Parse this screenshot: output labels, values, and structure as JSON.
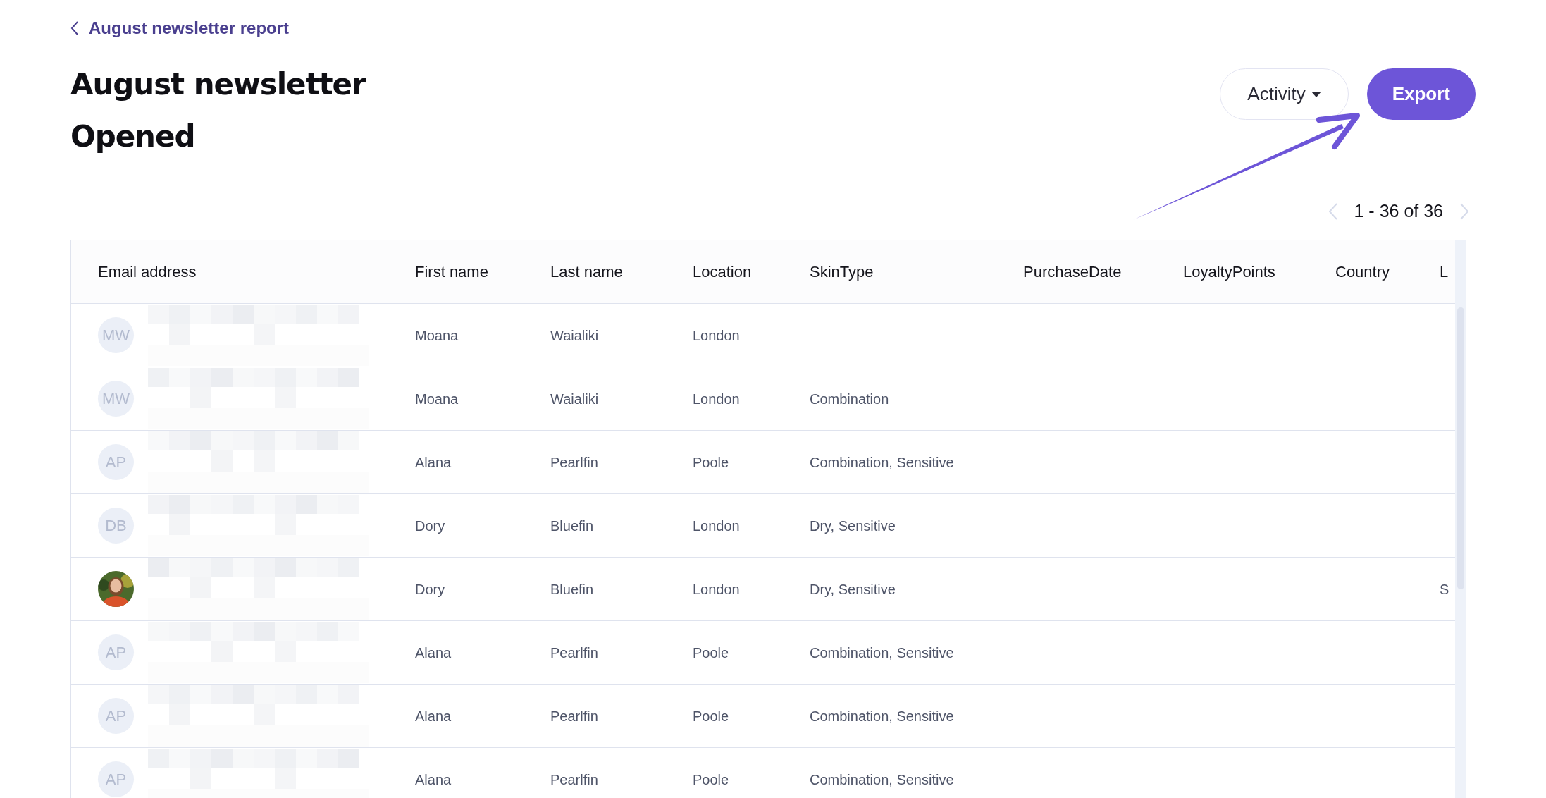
{
  "back_link": {
    "label": "August newsletter report"
  },
  "title": [
    "August newsletter",
    "Opened"
  ],
  "actions": {
    "activity": {
      "label": "Activity"
    },
    "export": {
      "label": "Export"
    }
  },
  "pagination": {
    "range": "1 - 36 of 36"
  },
  "table": {
    "columns": [
      "Email address",
      "First name",
      "Last name",
      "Location",
      "SkinType",
      "PurchaseDate",
      "LoyaltyPoints",
      "Country",
      "L"
    ],
    "rows": [
      {
        "avatar": {
          "kind": "initials",
          "initials": "MW"
        },
        "first_name": "Moana",
        "last_name": "Waialiki",
        "location": "London"
      },
      {
        "avatar": {
          "kind": "initials",
          "initials": "MW"
        },
        "first_name": "Moana",
        "last_name": "Waialiki",
        "location": "London",
        "skin_type": "Combination"
      },
      {
        "avatar": {
          "kind": "initials",
          "initials": "AP"
        },
        "first_name": "Alana",
        "last_name": "Pearlfin",
        "location": "Poole",
        "skin_type": "Combination, Sensitive"
      },
      {
        "avatar": {
          "kind": "initials",
          "initials": "DB"
        },
        "first_name": "Dory",
        "last_name": "Bluefin",
        "location": "London",
        "skin_type": "Dry, Sensitive"
      },
      {
        "first_name": "Dory",
        "last_name": "Bluefin",
        "location": "London",
        "skin_type": "Dry, Sensitive",
        "column_9": "S"
      },
      {
        "avatar": {
          "kind": "initials",
          "initials": "AP"
        },
        "first_name": "Alana",
        "last_name": "Pearlfin",
        "location": "Poole",
        "skin_type": "Combination, Sensitive"
      },
      {
        "avatar": {
          "kind": "initials",
          "initials": "AP"
        },
        "first_name": "Alana",
        "last_name": "Pearlfin",
        "location": "Poole",
        "skin_type": "Combination, Sensitive"
      },
      {
        "avatar": {
          "kind": "initials",
          "initials": "AP"
        },
        "first_name": "Alana",
        "last_name": "Pearlfin",
        "location": "Poole",
        "skin_type": "Combination, Sensitive"
      }
    ]
  }
}
